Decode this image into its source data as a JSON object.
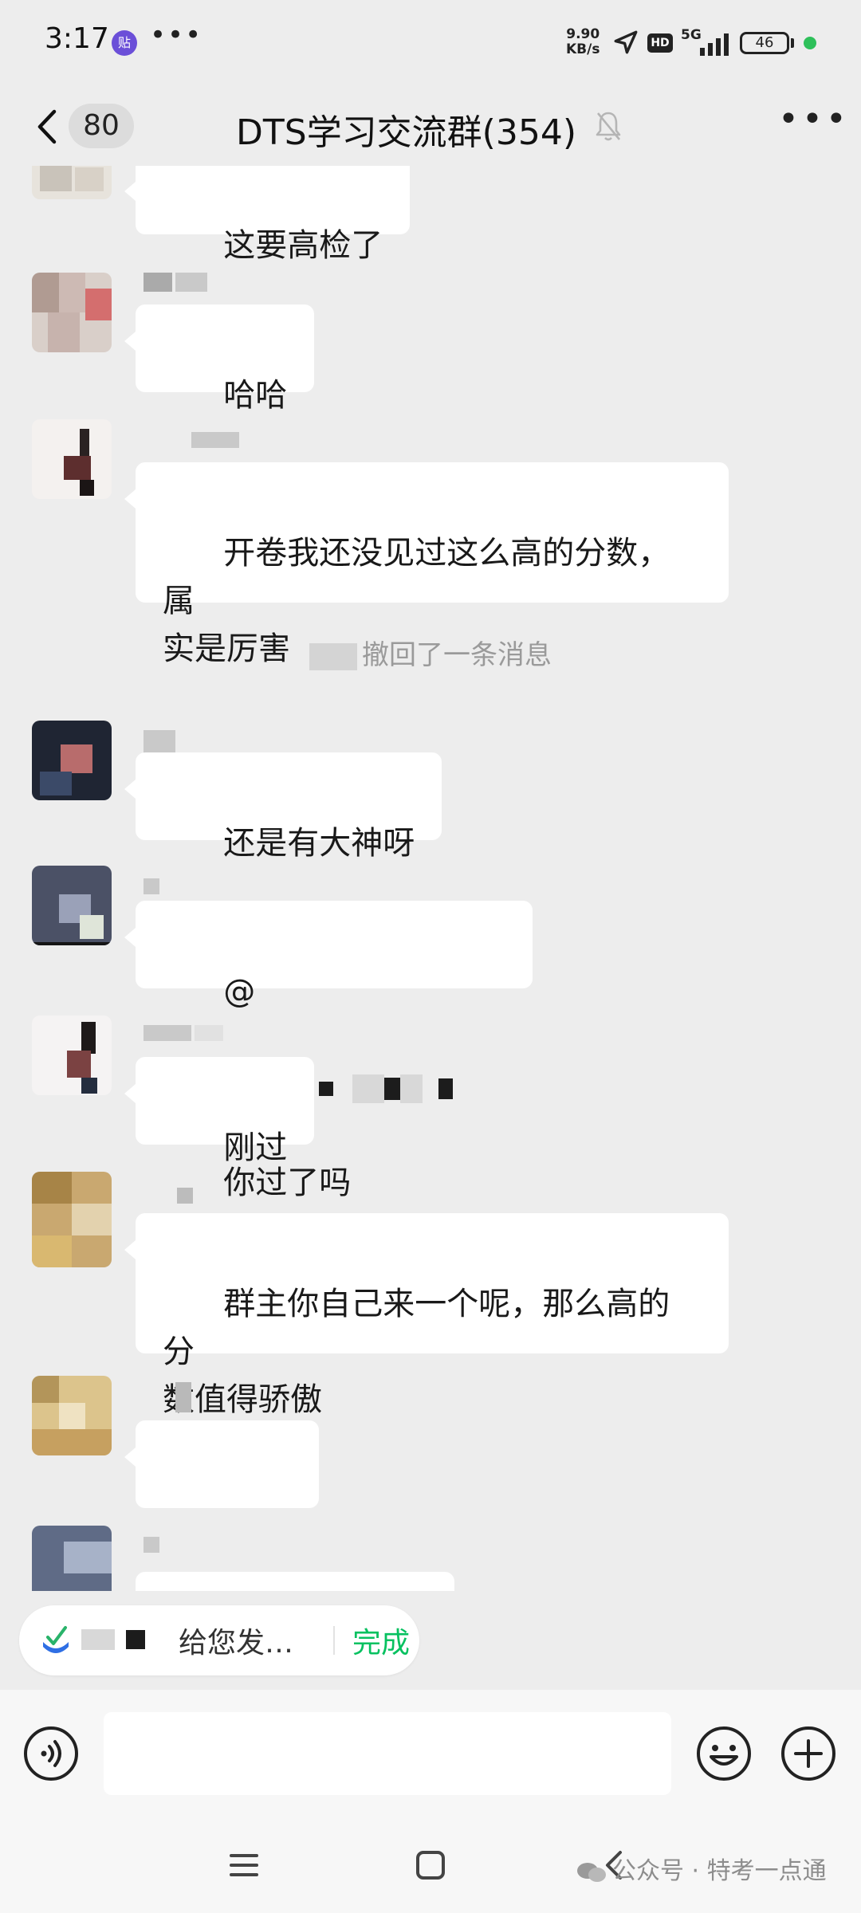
{
  "status_bar": {
    "time": "3:17",
    "app_badge": "贴",
    "speed_value": "9.90",
    "speed_unit": "KB/s",
    "hd": "HD",
    "network": "5G",
    "battery": "46"
  },
  "header": {
    "unread_count": "80",
    "title": "DTS学习交流群(354)"
  },
  "messages": [
    {
      "text": "这要高检了"
    },
    {
      "text": "哈哈"
    },
    {
      "text": "开卷我还没见过这么高的分数，属\n实是厉害"
    },
    {
      "text": "还是有大神呀"
    },
    {
      "mention_symbol": "@",
      "text": "你过了吗"
    },
    {
      "text": "刚过"
    },
    {
      "text": "群主你自己来一个呢，那么高的分\n数值得骄傲"
    }
  ],
  "system_notice": "撤回了一条消息",
  "notification": {
    "text": "给您发…",
    "action": "完成"
  },
  "input": {
    "placeholder": ""
  },
  "watermark": "公众号 · 特考一点通",
  "colors": {
    "accent": "#07c160",
    "background": "#ededed",
    "bubble": "#ffffff"
  }
}
